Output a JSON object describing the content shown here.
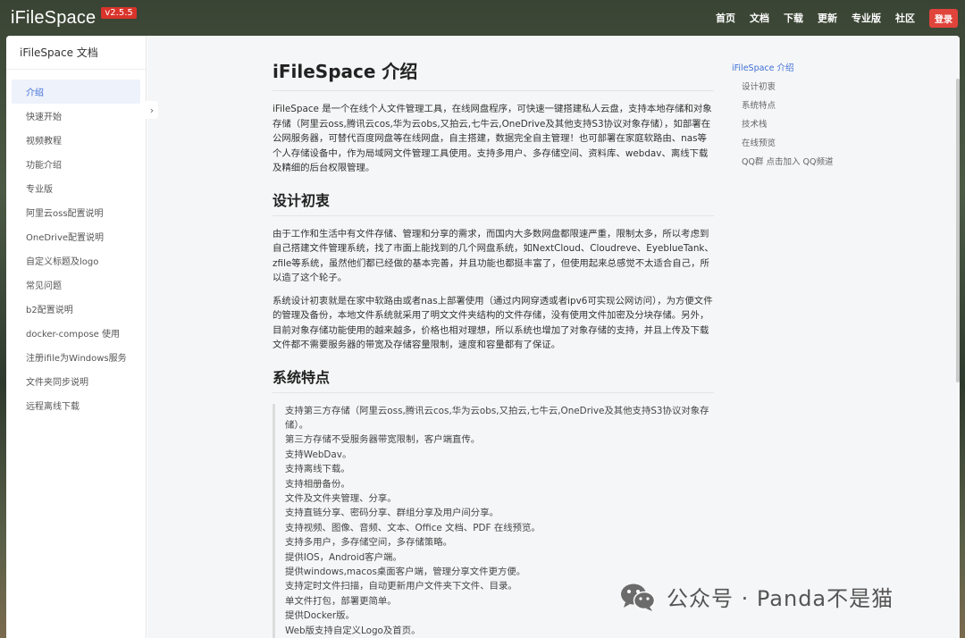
{
  "header": {
    "brand": "iFileSpace",
    "version": "v2.5.5",
    "nav": [
      "首页",
      "文档",
      "下载",
      "更新",
      "专业版",
      "社区"
    ],
    "login": "登录"
  },
  "sidebar": {
    "title": "iFileSpace 文档",
    "items": [
      "介绍",
      "快速开始",
      "视频教程",
      "功能介绍",
      "专业版",
      "阿里云oss配置说明",
      "OneDrive配置说明",
      "自定义标题及logo",
      "常见问题",
      "b2配置说明",
      "docker-compose 使用",
      "注册ifile为Windows服务",
      "文件夹同步说明",
      "远程离线下载"
    ],
    "toggle_icon": "chevron-right-icon"
  },
  "article": {
    "title": "iFileSpace 介绍",
    "intro": "iFileSpace 是一个在线个人文件管理工具，在线网盘程序，可快速一键搭建私人云盘，支持本地存储和对象存储（阿里云oss,腾讯云cos,华为云obs,又拍云,七牛云,OneDrive及其他支持S3协议对象存储），如部署在公网服务器，可替代百度网盘等在线网盘，自主搭建，数据完全自主管理！也可部署在家庭软路由、nas等个人存储设备中，作为局域网文件管理工具使用。支持多用户、多存储空间、资料库、webdav、离线下载及精细的后台权限管理。",
    "section1_title": "设计初衷",
    "section1_p1": "由于工作和生活中有文件存储、管理和分享的需求，而国内大多数网盘都限速严重，限制太多，所以考虑到自己搭建文件管理系统，找了市面上能找到的几个网盘系统，如NextCloud、Cloudreve、EyeblueTank、zfile等系统，虽然他们都已经做的基本完善，并且功能也都挺丰富了，但使用起来总感觉不太适合自己，所以造了这个轮子。",
    "section1_p2": "系统设计初衷就是在家中软路由或者nas上部署使用（通过内网穿透或者ipv6可实现公网访问），为方便文件的管理及备份，本地文件系统就采用了明文文件夹结构的文件存储，没有使用文件加密及分块存储。另外，目前对象存储功能使用的越来越多，价格也相对理想，所以系统也增加了对象存储的支持，并且上传及下载文件都不需要服务器的带宽及存储容量限制，速度和容量都有了保证。",
    "section2_title": "系统特点",
    "features": [
      "支持第三方存储（阿里云oss,腾讯云cos,华为云obs,又拍云,七牛云,OneDrive及其他支持S3协议对象存储）。",
      "第三方存储不受服务器带宽限制，客户端直传。",
      "支持WebDav。",
      "支持离线下载。",
      "支持相册备份。",
      "文件及文件夹管理、分享。",
      "支持直链分享、密码分享、群组分享及用户间分享。",
      "支持视频、图像、音频、文本、Office 文档、PDF 在线预览。",
      "支持多用户，多存储空间，多存储策略。",
      "提供IOS，Android客户端。",
      "提供windows,macos桌面客户端，管理分享文件更方便。",
      "支持定时文件扫描，自动更新用户文件夹下文件、目录。",
      "单文件打包，部署更简单。",
      "提供Docker版。",
      "Web版支持自定义Logo及首页。"
    ]
  },
  "toc": {
    "items": [
      "iFileSpace 介绍",
      "设计初衷",
      "系统特点",
      "技术栈",
      "在线预览",
      "QQ群 点击加入 QQ频道"
    ]
  },
  "watermark": {
    "text": "公众号 · Panda不是猫",
    "icon": "wechat-icon"
  },
  "colors": {
    "accent": "#3e6fd8",
    "version_badge": "#d9342b",
    "login_button": "#e0443b"
  }
}
